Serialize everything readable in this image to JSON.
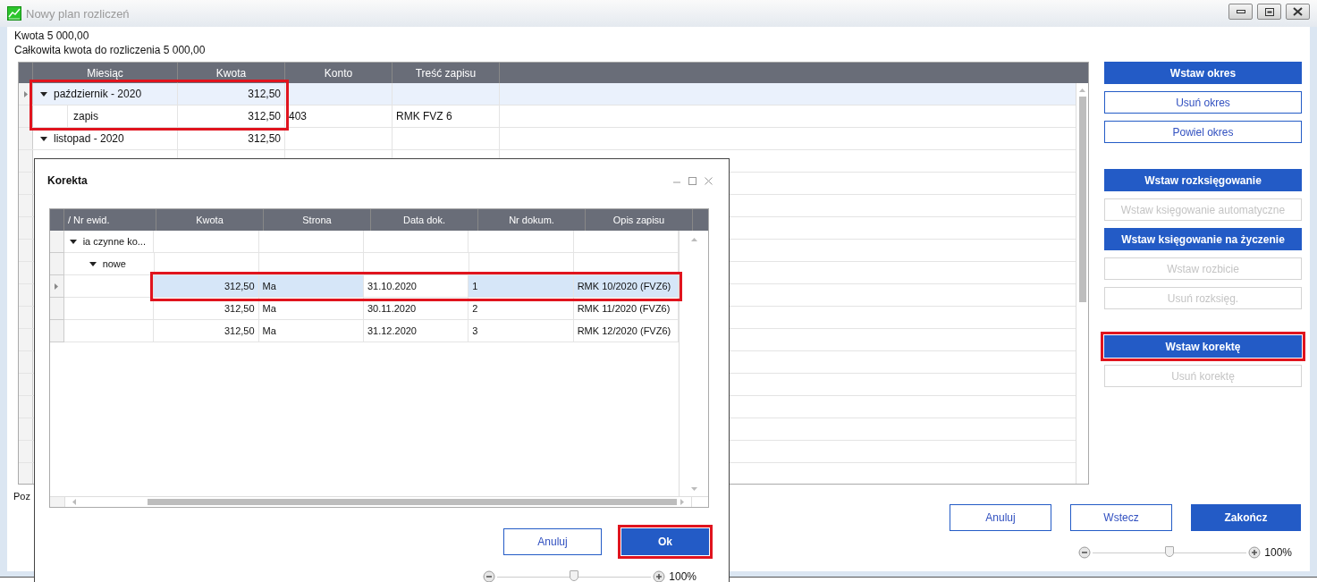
{
  "window": {
    "title": "Nowy plan rozliczeń"
  },
  "summary": [
    "Kwota 5 000,00",
    "Całkowita kwota do rozliczenia 5 000,00"
  ],
  "grid": {
    "columns": [
      "Miesiąc",
      "Kwota",
      "Konto",
      "Treść zapisu"
    ],
    "rows": [
      {
        "label": "październik - 2020",
        "kwota": "312,50",
        "expanded": true,
        "selected": true,
        "highlighted": true,
        "children": [
          {
            "label": "zapis",
            "kwota": "312,50",
            "konto": "403",
            "tresc": "RMK FVZ 6"
          }
        ]
      },
      {
        "label": "listopad - 2020",
        "kwota": "312,50",
        "expanded": true,
        "selected": false,
        "highlighted": false,
        "children": []
      }
    ]
  },
  "status_text": "Poz",
  "side_panel": {
    "groups": [
      [
        {
          "label": "Wstaw okres",
          "kind": "primary"
        },
        {
          "label": "Usuń okres",
          "kind": "outline"
        },
        {
          "label": "Powiel okres",
          "kind": "outline"
        }
      ],
      [
        {
          "label": "Wstaw rozksięgowanie",
          "kind": "primary"
        },
        {
          "label": "Wstaw księgowanie automatyczne",
          "kind": "disabled"
        },
        {
          "label": "Wstaw księgowanie na życzenie",
          "kind": "primary"
        },
        {
          "label": "Wstaw rozbicie",
          "kind": "disabled"
        },
        {
          "label": "Usuń rozksięg.",
          "kind": "disabled"
        }
      ],
      [
        {
          "label": "Wstaw korektę",
          "kind": "primary",
          "highlighted": true
        },
        {
          "label": "Usuń korektę",
          "kind": "disabled"
        }
      ]
    ]
  },
  "footer_buttons": [
    {
      "label": "Anuluj",
      "kind": "outline"
    },
    {
      "label": "Wstecz",
      "kind": "outline"
    },
    {
      "label": "Zakończ",
      "kind": "primary"
    }
  ],
  "zoom": {
    "level": 0.5,
    "reading": "100%"
  },
  "dialog": {
    "title": "Korekta",
    "columns": [
      "/ Nr ewid.",
      "Kwota",
      "Strona",
      "Data dok.",
      "Nr dokum.",
      "Opis zapisu"
    ],
    "groups": [
      {
        "label": "ia czynne ko...",
        "expanded": true,
        "children": [
          {
            "label": "nowe",
            "expanded": true,
            "rows": [
              {
                "kwota": "312,50",
                "strona": "Ma",
                "data": "31.10.2020",
                "nr": "1",
                "opis": "RMK 10/2020 (FVZ6)",
                "selected": true,
                "highlighted": true
              },
              {
                "kwota": "312,50",
                "strona": "Ma",
                "data": "30.11.2020",
                "nr": "2",
                "opis": "RMK 11/2020 (FVZ6)",
                "selected": false,
                "highlighted": false
              },
              {
                "kwota": "312,50",
                "strona": "Ma",
                "data": "31.12.2020",
                "nr": "3",
                "opis": "RMK 12/2020 (FVZ6)",
                "selected": false,
                "highlighted": false
              }
            ]
          }
        ]
      }
    ],
    "buttons": [
      {
        "label": "Anuluj",
        "kind": "outline"
      },
      {
        "label": "Ok",
        "kind": "primary",
        "highlighted": true
      }
    ],
    "zoom": {
      "level": 0.5,
      "reading": "100%"
    }
  }
}
